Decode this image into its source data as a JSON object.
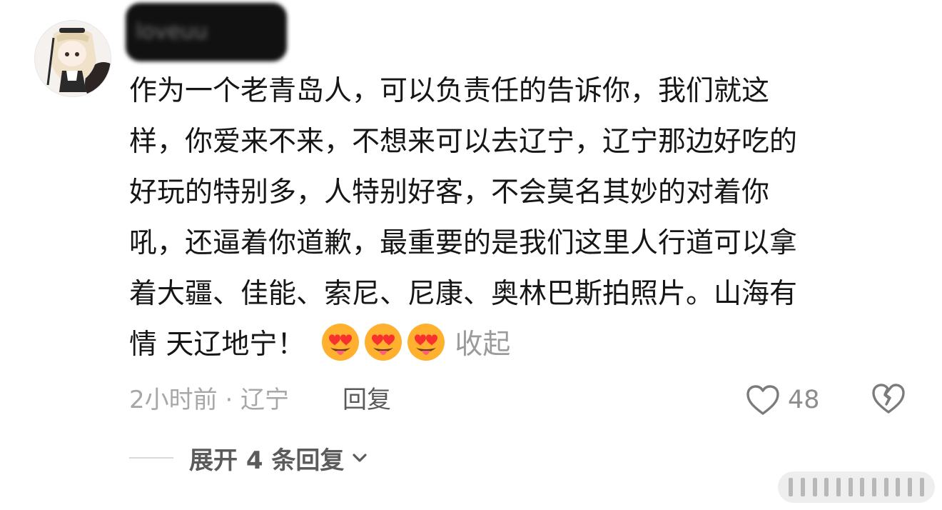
{
  "comment": {
    "username": "loveuu",
    "lines": [
      "作为一个老青岛人，可以负责任的告诉你，我们就这",
      "样，你爱来不来，不想来可以去辽宁，辽宁那边好吃的",
      "好玩的特别多，人特别好客，不会莫名其妙的对着你",
      "吼，还逼着你道歉，最重要的是我们这里人行道可以拿",
      "着大疆、佳能、索尼、尼康、奥林巴斯拍照片。山海有",
      "情 天辽地宁！"
    ],
    "emojis": [
      "heart-eyes-tongue-emoji",
      "heart-eyes-tongue-emoji",
      "heart-eyes-tongue-emoji"
    ],
    "collapse_label": "收起",
    "meta": "2小时前 · 辽宁",
    "reply_label": "回复",
    "like_count": "48"
  },
  "expand": {
    "label": "展开 4 条回复"
  },
  "colors": {
    "text": "#161616",
    "muted": "#a7a7a7",
    "emoji_face": "#ffb02e",
    "emoji_heart": "#f8312f"
  },
  "icons": {
    "like": "heart-outline-icon",
    "dislike": "broken-heart-icon",
    "expand": "chevron-down-icon"
  }
}
